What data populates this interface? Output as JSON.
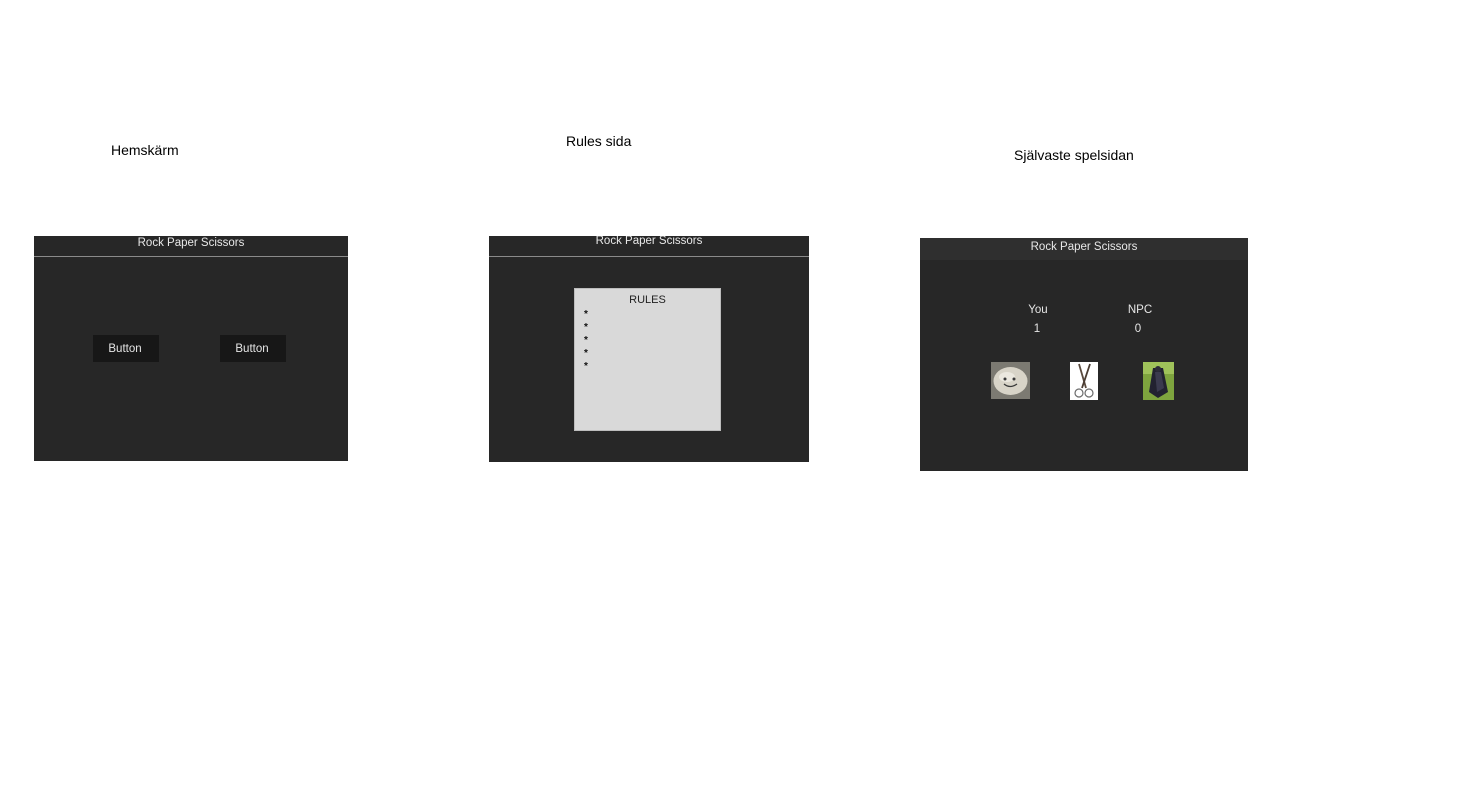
{
  "captions": {
    "home": "Hemskärm",
    "rules": "Rules sida",
    "game": "Självaste spelsidan"
  },
  "app_title": "Rock Paper Scissors",
  "home_screen": {
    "button_left": "Button",
    "button_right": "Button"
  },
  "rules_screen": {
    "heading": "RULES",
    "items": [
      "*",
      "*",
      "*",
      "*",
      "*"
    ]
  },
  "game_screen": {
    "player_label": "You",
    "npc_label": "NPC",
    "player_score": "1",
    "npc_score": "0",
    "choices": [
      {
        "icon": "rock-icon"
      },
      {
        "icon": "scissors-icon"
      },
      {
        "icon": "paper-icon"
      }
    ]
  },
  "colors": {
    "panel_bg": "#272727",
    "button_bg": "#171717",
    "rules_card_bg": "#d9d9d9",
    "title_text": "#e8e8e8"
  }
}
